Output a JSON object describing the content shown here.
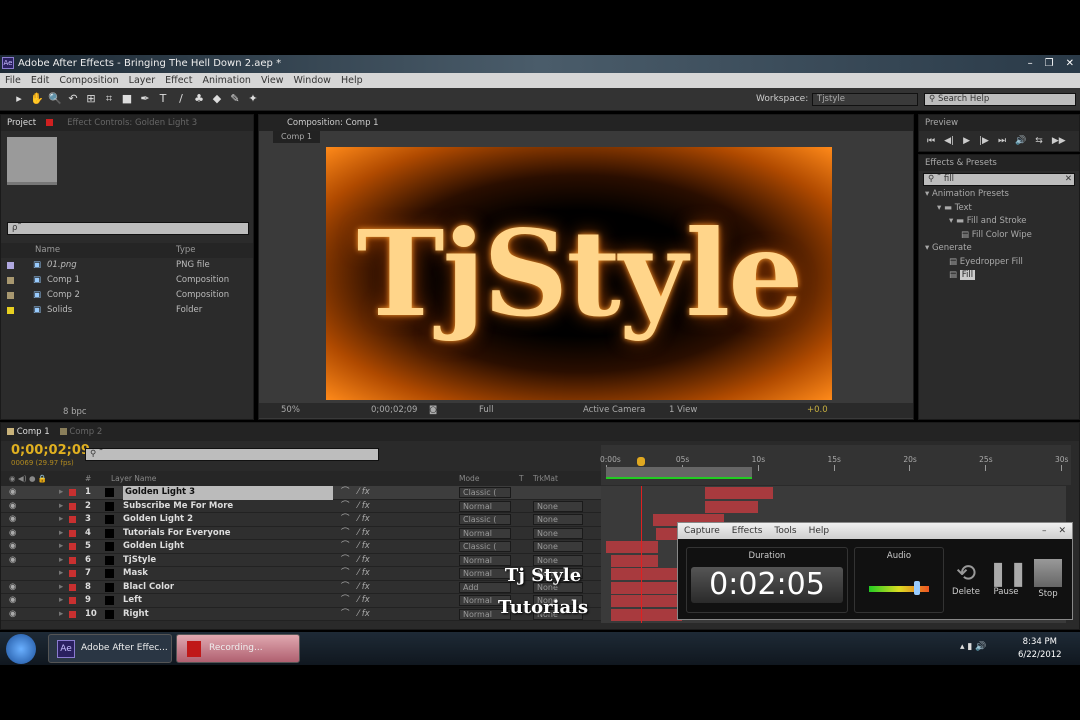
{
  "window": {
    "title": "Adobe After Effects - Bringing The Hell Down 2.aep *",
    "app_badge": "Ae",
    "controls": [
      "–",
      "❐",
      "✕"
    ]
  },
  "menu": [
    "File",
    "Edit",
    "Composition",
    "Layer",
    "Effect",
    "Animation",
    "View",
    "Window",
    "Help"
  ],
  "toolbar": {
    "tools": [
      "▸",
      "✋",
      "🔍",
      "↶",
      "⊞",
      "⌗",
      "■",
      "✒",
      "T",
      "/",
      "♣",
      "◆",
      "✎",
      "✦"
    ],
    "workspace_label": "Workspace:",
    "workspace_value": "Tjstyle",
    "search_help": "Search Help"
  },
  "project": {
    "tab": "Project",
    "effect_controls_tab": "Effect Controls: Golden Light 3",
    "search_placeholder": "ρ˜",
    "col_name": "Name",
    "col_type": "Type",
    "items": [
      {
        "name": "01.png",
        "type": "PNG file",
        "color": "#b0a8e0"
      },
      {
        "name": "Comp 1",
        "type": "Composition",
        "color": "#a89870"
      },
      {
        "name": "Comp 2",
        "type": "Composition",
        "color": "#a89870"
      },
      {
        "name": "Solids",
        "type": "Folder",
        "color": "#e8d020"
      }
    ],
    "bpc": "8 bpc"
  },
  "composition": {
    "tab": "Composition: Comp 1",
    "sub_tab": "Comp 1",
    "logo_text": "TjStyle",
    "zoom": "50%",
    "timecode": "0;00;02;09",
    "resolution": "Full",
    "camera": "Active Camera",
    "views": "1 View",
    "exposure": "+0.0"
  },
  "preview": {
    "tab": "Preview",
    "controls": [
      "⏮",
      "◀|",
      "▶",
      "|▶",
      "⏭",
      "🔊",
      "⇆",
      "▶▶"
    ]
  },
  "effects": {
    "tab": "Effects & Presets",
    "search": "fill",
    "tree": [
      {
        "label": "Animation Presets",
        "level": 0,
        "kind": "group"
      },
      {
        "label": "Text",
        "level": 1,
        "kind": "folder"
      },
      {
        "label": "Fill and Stroke",
        "level": 2,
        "kind": "folder"
      },
      {
        "label": "Fill Color Wipe",
        "level": 3,
        "kind": "preset"
      },
      {
        "label": "Generate",
        "level": 0,
        "kind": "group"
      },
      {
        "label": "Eyedropper Fill",
        "level": 2,
        "kind": "effect"
      },
      {
        "label": "Fill",
        "level": 2,
        "kind": "effect",
        "selected": true
      }
    ]
  },
  "timeline": {
    "tabs": [
      "Comp 1",
      "Comp 2"
    ],
    "timecode": "0;00;02;09",
    "frames": "00069 (29.97 fps)",
    "col_layer": "Layer Name",
    "col_num": "#",
    "col_mode": "Mode",
    "col_t": "T",
    "col_trkmat": "TrkMat",
    "ruler": [
      "0:00s",
      "05s",
      "10s",
      "15s",
      "20s",
      "25s",
      "30s"
    ],
    "duration_s": 30,
    "playhead_s": 2.3,
    "work_area_end_s": 9.6,
    "layers": [
      {
        "num": "1",
        "name": "Golden Light 3",
        "mode": "Classic (",
        "trkmat": "",
        "in": 6.5,
        "out": 11,
        "selected": true
      },
      {
        "num": "2",
        "name": "Subscribe Me    For More",
        "mode": "Normal",
        "trkmat": "None",
        "in": 6.5,
        "out": 10
      },
      {
        "num": "3",
        "name": "Golden Light 2",
        "mode": "Classic (",
        "trkmat": "None",
        "in": 3.1,
        "out": 7.8
      },
      {
        "num": "4",
        "name": "Tutorials For  Everyone",
        "mode": "Normal",
        "trkmat": "None",
        "in": 3.3,
        "out": 5
      },
      {
        "num": "5",
        "name": "Golden Light",
        "mode": "Classic (",
        "trkmat": "None",
        "in": 0,
        "out": 3.4
      },
      {
        "num": "6",
        "name": "TjStyle",
        "mode": "Normal",
        "trkmat": "None",
        "in": 0.3,
        "out": 3.4
      },
      {
        "num": "7",
        "name": "Mask",
        "mode": "Normal",
        "trkmat": "None",
        "in": 0.3,
        "out": 5
      },
      {
        "num": "8",
        "name": "Blacl Color",
        "mode": "Add",
        "trkmat": "None",
        "in": 0.3,
        "out": 5
      },
      {
        "num": "9",
        "name": "Left",
        "mode": "Normal",
        "trkmat": "None",
        "in": 0.3,
        "out": 5
      },
      {
        "num": "10",
        "name": "Right",
        "mode": "Normal",
        "trkmat": "None",
        "in": 0.3,
        "out": 5
      }
    ]
  },
  "watermark": {
    "line1": "Tj Style",
    "line2": "Tutorials"
  },
  "recorder": {
    "menu": [
      "Capture",
      "Effects",
      "Tools",
      "Help"
    ],
    "duration_label": "Duration",
    "duration": "0:02:05",
    "audio_label": "Audio",
    "audio_level": 0.8,
    "delete": "Delete",
    "pause": "Pause",
    "stop": "Stop"
  },
  "taskbar": {
    "ae_task": "Adobe After Effec...",
    "rec_task": "Recording...",
    "time": "8:34 PM",
    "date": "6/22/2012"
  }
}
